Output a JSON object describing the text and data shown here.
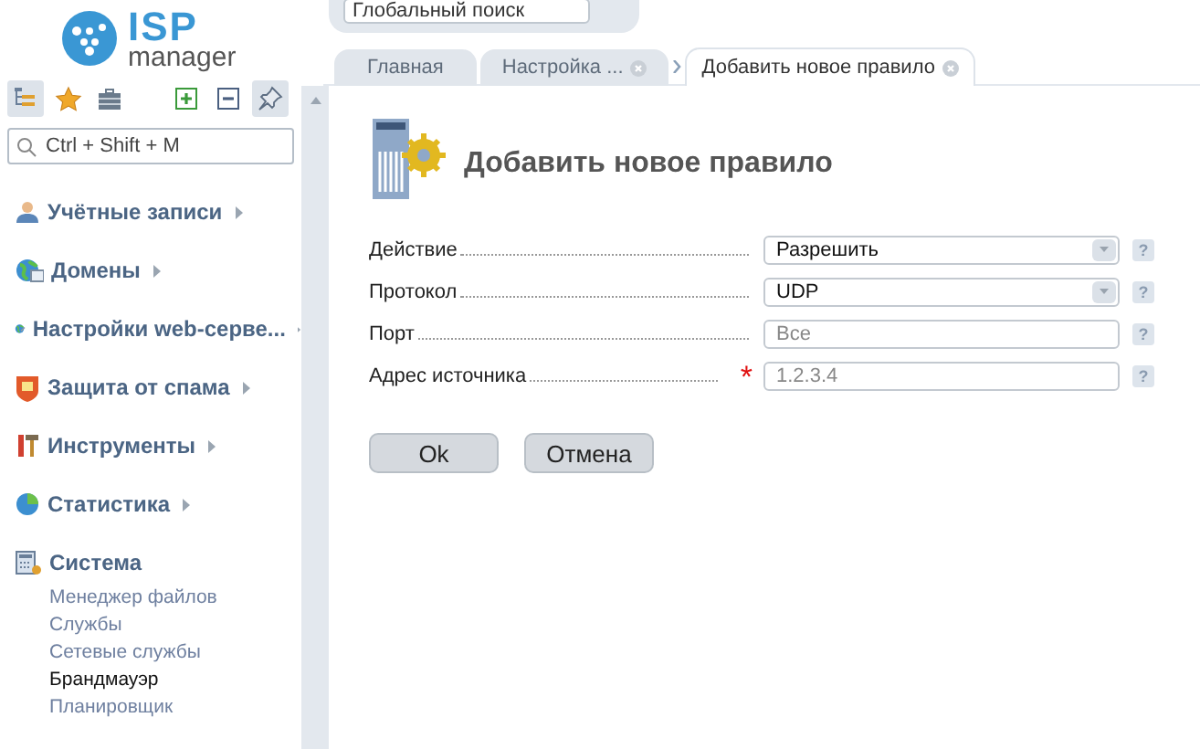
{
  "logo": {
    "brand": "ISP",
    "sub": "manager"
  },
  "global_search": {
    "placeholder": "Глобальный поиск"
  },
  "tabs": [
    {
      "label": "Главная",
      "selected": false,
      "closable": false
    },
    {
      "label": "Настройка ...",
      "selected": false,
      "closable": true
    },
    {
      "label": "Добавить новое правило",
      "selected": true,
      "closable": true
    }
  ],
  "sidebar": {
    "toolbar": [
      {
        "kind": "tree",
        "selected": true
      },
      {
        "kind": "star",
        "selected": false
      },
      {
        "kind": "briefcase",
        "selected": false
      },
      {
        "kind": "plus",
        "selected": false
      },
      {
        "kind": "minus",
        "selected": false
      },
      {
        "kind": "pin",
        "selected": true
      }
    ],
    "search": {
      "placeholder": "Ctrl + Shift + M"
    },
    "items": [
      {
        "label": "Учётные записи",
        "kind": "user",
        "expanded": false
      },
      {
        "label": "Домены",
        "kind": "globe",
        "expanded": false
      },
      {
        "label": "Настройки web-серве...",
        "kind": "web",
        "expanded": false
      },
      {
        "label": "Защита от спама",
        "kind": "shield",
        "expanded": false
      },
      {
        "label": "Инструменты",
        "kind": "tools",
        "expanded": false
      },
      {
        "label": "Статистика",
        "kind": "chart",
        "expanded": false
      },
      {
        "label": "Система",
        "kind": "system",
        "expanded": true,
        "children": [
          {
            "label": "Менеджер файлов",
            "selected": false
          },
          {
            "label": "Службы",
            "selected": false
          },
          {
            "label": "Сетевые службы",
            "selected": false
          },
          {
            "label": "Брандмауэр",
            "selected": true
          },
          {
            "label": "Планировщик",
            "selected": false
          }
        ]
      }
    ]
  },
  "form": {
    "title": "Добавить новое правило",
    "fields": [
      {
        "label": "Действие",
        "kind": "select",
        "value": "Разрешить",
        "required": false,
        "help": "?"
      },
      {
        "label": "Протокол",
        "kind": "select",
        "value": "UDP",
        "required": false,
        "help": "?"
      },
      {
        "label": "Порт",
        "kind": "input",
        "placeholder": "Все",
        "required": false,
        "help": "?"
      },
      {
        "label": "Адрес источника",
        "kind": "input",
        "placeholder": "1.2.3.4",
        "required": true,
        "required_mark": "*",
        "help": "?"
      }
    ],
    "buttons": [
      "Ok",
      "Отмена"
    ]
  }
}
